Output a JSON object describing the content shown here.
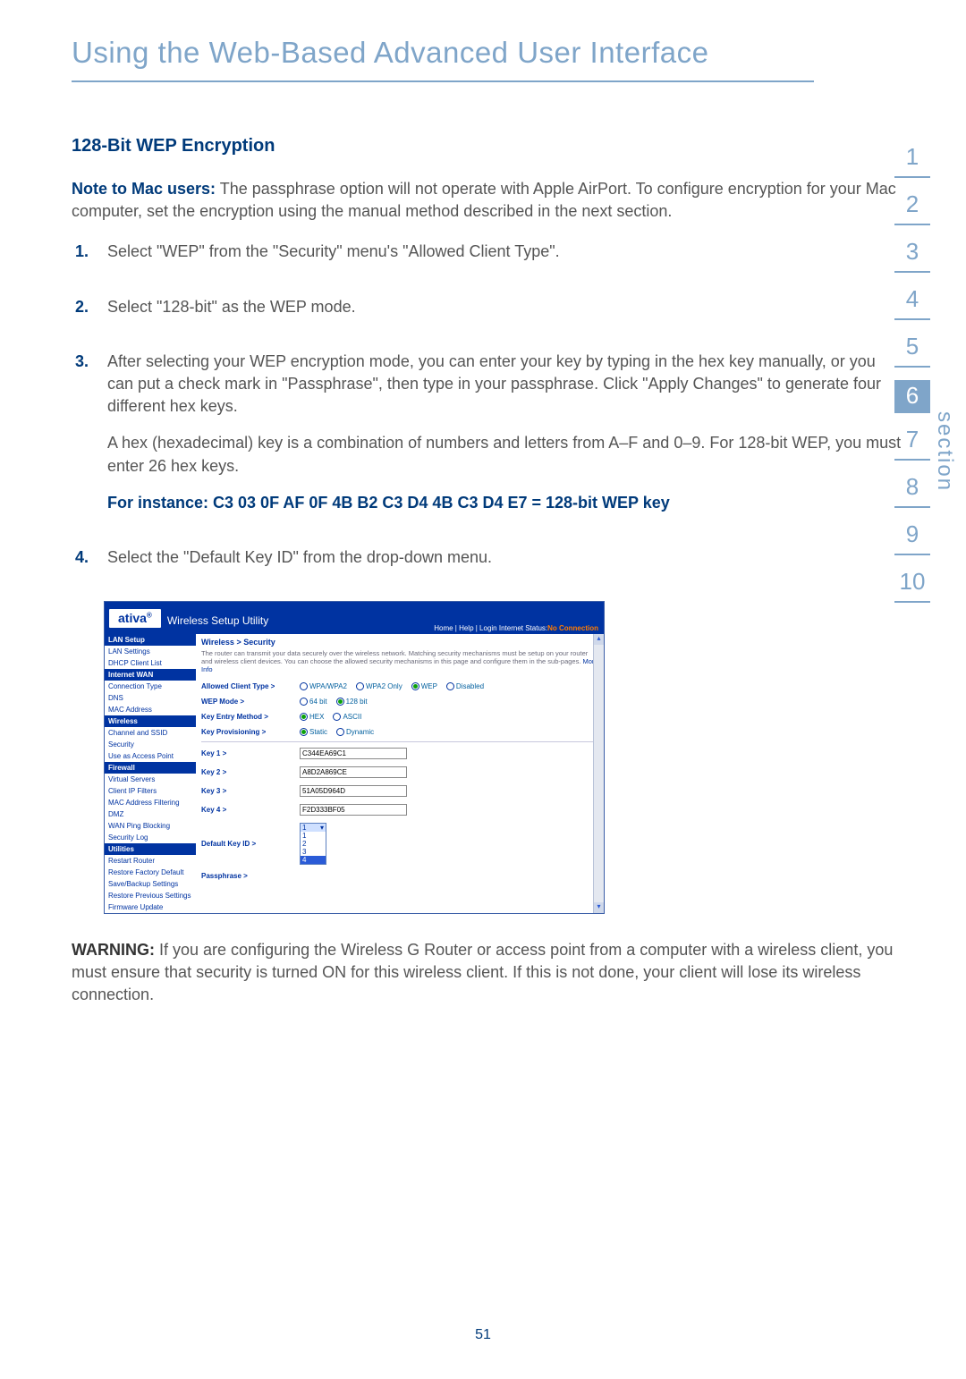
{
  "page_title": "Using the Web-Based Advanced User Interface",
  "page_number": "51",
  "section_tabs": [
    "1",
    "2",
    "3",
    "4",
    "5",
    "6",
    "7",
    "8",
    "9",
    "10"
  ],
  "section_active_index": 5,
  "section_label": "section",
  "heading": "128-Bit WEP Encryption",
  "note_label": "Note to Mac users:",
  "note_text": " The passphrase option will not operate with Apple AirPort. To configure encryption for your Mac computer, set the encryption using the manual method described in the next section.",
  "steps": [
    {
      "n": "1.",
      "body": [
        "Select \"WEP\" from the \"Security\" menu's \"Allowed Client Type\"."
      ]
    },
    {
      "n": "2.",
      "body": [
        "Select \"128-bit\" as the WEP mode."
      ]
    },
    {
      "n": "3.",
      "body": [
        "After selecting your WEP encryption mode, you can enter your key by typing in the hex key manually, or you can put a check mark in \"Passphrase\", then type in your passphrase. Click \"Apply Changes\" to generate four different hex keys.",
        "A hex (hexadecimal) key is a combination of numbers and letters from A–F and 0–9. For 128-bit WEP, you must enter 26 hex keys."
      ],
      "example": "For instance:  C3 03 0F AF 0F 4B B2 C3 D4 4B C3 D4 E7 = 128-bit WEP key"
    },
    {
      "n": "4.",
      "body": [
        "Select the \"Default Key ID\" from the drop-down menu."
      ]
    }
  ],
  "warning_label": "WARNING:",
  "warning_text": " If you are configuring the Wireless G Router or access point from a computer with a wireless client, you must ensure that security is turned ON for this wireless client. If this is not done, your client will lose its wireless connection.",
  "router": {
    "logo": "ativa",
    "utility_title": "Wireless Setup Utility",
    "topnav": "Home | Help | Login   Internet Status:",
    "status_value": "No Connection",
    "sidebar": {
      "groups": [
        {
          "title": "LAN Setup",
          "items": [
            "LAN Settings",
            "DHCP Client List"
          ]
        },
        {
          "title": "Internet WAN",
          "items": [
            "Connection Type",
            "DNS",
            "MAC Address"
          ]
        },
        {
          "title": "Wireless",
          "items": [
            "Channel and SSID",
            "Security",
            "Use as Access Point"
          ]
        },
        {
          "title": "Firewall",
          "items": [
            "Virtual Servers",
            "Client IP Filters",
            "MAC Address Filtering",
            "DMZ",
            "WAN Ping Blocking",
            "Security Log"
          ]
        },
        {
          "title": "Utilities",
          "items": [
            "Restart Router",
            "Restore Factory Default",
            "Save/Backup Settings",
            "Restore Previous Settings",
            "Firmware Update"
          ]
        }
      ]
    },
    "breadcrumb": "Wireless > Security",
    "description": "The router can transmit your data securely over the wireless network. Matching security mechanisms must be setup on your router and wireless client devices. You can choose the allowed security mechanisms in this page and configure them in the sub-pages. ",
    "more_info": "More Info",
    "rows": {
      "client_type": {
        "label": "Allowed Client Type >",
        "options": [
          "WPA/WPA2",
          "WPA2 Only",
          "WEP",
          "Disabled"
        ],
        "selected": "WEP"
      },
      "wep_mode": {
        "label": "WEP Mode >",
        "options": [
          "64 bit",
          "128 bit"
        ],
        "selected": "128 bit"
      },
      "key_method": {
        "label": "Key Entry Method >",
        "options": [
          "HEX",
          "ASCII"
        ],
        "selected": "HEX"
      },
      "key_prov": {
        "label": "Key Provisioning >",
        "options": [
          "Static",
          "Dynamic"
        ],
        "selected": "Static"
      },
      "keys": [
        {
          "label": "Key 1 >",
          "value": "C344EA69C1"
        },
        {
          "label": "Key 2 >",
          "value": "A8D2A869CE"
        },
        {
          "label": "Key 3 >",
          "value": "51A05D964D"
        },
        {
          "label": "Key 4 >",
          "value": "F2D333BF05"
        }
      ],
      "default_key": {
        "label": "Default Key ID >",
        "selected": "1",
        "options": [
          "1",
          "2",
          "3",
          "4"
        ]
      },
      "passphrase": {
        "label": "Passphrase >"
      }
    }
  }
}
